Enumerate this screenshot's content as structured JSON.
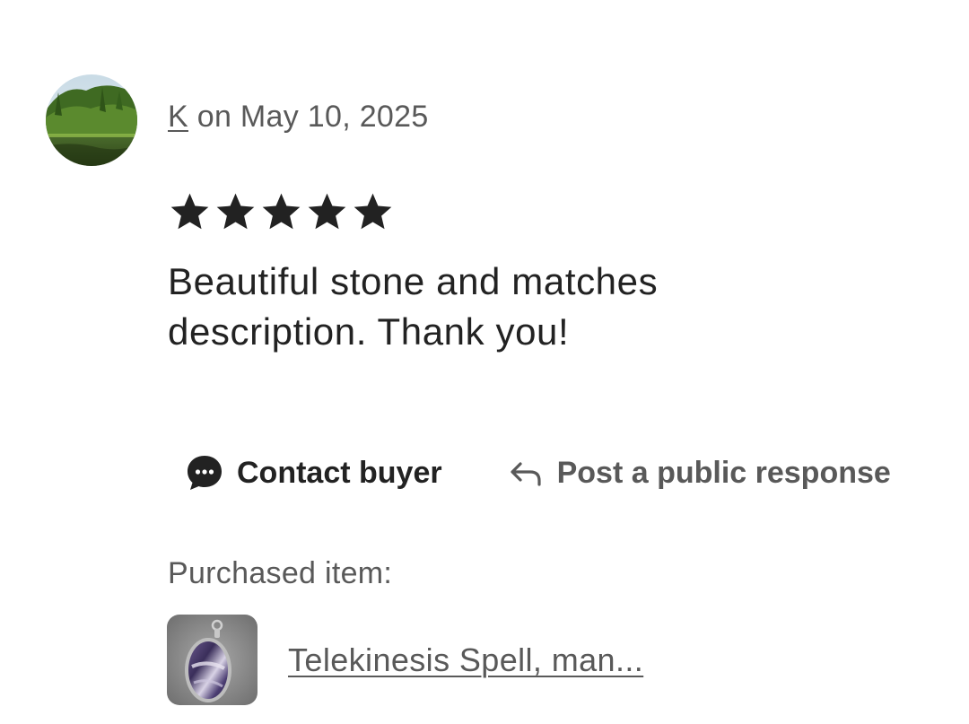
{
  "review": {
    "reviewer_name": "K",
    "date_text": "on May 10, 2025",
    "rating": 5,
    "rating_max": 5,
    "text": "Beautiful stone and matches description. Thank you!"
  },
  "actions": {
    "contact_label": "Contact buyer",
    "contact_icon": "chat-bubble-icon",
    "respond_label": "Post a public response",
    "respond_icon": "reply-arrow-icon"
  },
  "purchase": {
    "label": "Purchased item:",
    "item_title": "Telekinesis Spell, man..."
  },
  "colors": {
    "primary_text": "#222222",
    "secondary_text": "#595959",
    "background": "#ffffff"
  }
}
